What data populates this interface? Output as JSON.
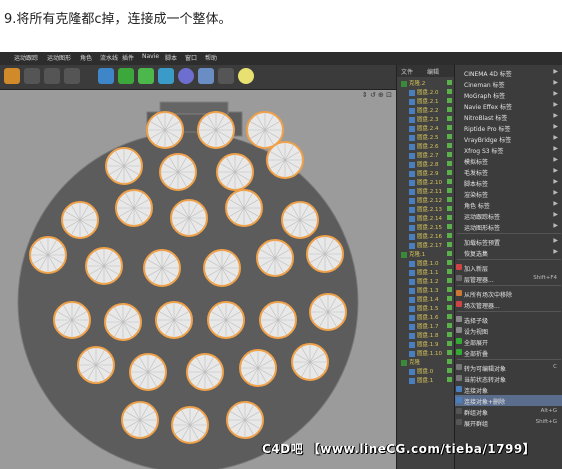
{
  "caption": "9.将所有克隆都c掉，连接成一个整体。",
  "menu_bar": [
    "运动跟踪",
    "运动图形",
    "角色",
    "流水线",
    "插件",
    "Navie",
    "脚本",
    "窗口",
    "帮助"
  ],
  "viewport_menu": "⇕ ↺ ⊕ ⊡",
  "object_panel": {
    "tabs": [
      "文件",
      "编辑"
    ],
    "top_item": "克隆.2",
    "items": [
      "圆盘.2.0",
      "圆盘.2.1",
      "圆盘.2.2",
      "圆盘.2.3",
      "圆盘.2.4",
      "圆盘.2.5",
      "圆盘.2.6",
      "圆盘.2.7",
      "圆盘.2.8",
      "圆盘.2.9",
      "圆盘.2.10",
      "圆盘.2.11",
      "圆盘.2.12",
      "圆盘.2.13",
      "圆盘.2.14",
      "圆盘.2.15",
      "圆盘.2.16",
      "圆盘.2.17"
    ],
    "group2": "克隆.1",
    "items2": [
      "圆盘.1.0",
      "圆盘.1.1",
      "圆盘.1.2",
      "圆盘.1.3",
      "圆盘.1.4",
      "圆盘.1.5",
      "圆盘.1.6",
      "圆盘.1.7",
      "圆盘.1.8",
      "圆盘.1.9",
      "圆盘.1.10"
    ],
    "group3": "克隆",
    "items3": [
      "圆盘.0",
      "圆盘.1"
    ]
  },
  "context_menu": {
    "submenus": [
      "CINEMA 4D 标签",
      "Cineman 标签",
      "MoGraph 标签",
      "Navie Effex 标签",
      "NitroBlast 标签",
      "Riptide Pro 标签",
      "VrayBridge 标签",
      "Xfrog S3 标签",
      "模拟标签",
      "毛发标签",
      "脚本标签",
      "渲染标签",
      "角色 标签",
      "运动跟踪标签",
      "运动图形标签"
    ],
    "presets": [
      "加载标签预置",
      "恢复选集"
    ],
    "items": [
      {
        "label": "加入新层",
        "shortcut": ""
      },
      {
        "label": "层管理器...",
        "shortcut": "Shift+F4"
      },
      {
        "label": "从所有场次中移除",
        "shortcut": ""
      },
      {
        "label": "场次管理器...",
        "shortcut": ""
      },
      {
        "label": "选择子级",
        "shortcut": ""
      },
      {
        "label": "设为视图",
        "shortcut": ""
      },
      {
        "label": "全部展开",
        "shortcut": ""
      },
      {
        "label": "全部折叠",
        "shortcut": ""
      },
      {
        "label": "转为可编辑对象",
        "shortcut": "C"
      },
      {
        "label": "当前状态转对象",
        "shortcut": ""
      },
      {
        "label": "连接对象",
        "shortcut": ""
      },
      {
        "label": "连接对象+删除",
        "shortcut": ""
      },
      {
        "label": "群组对象",
        "shortcut": "Alt+G"
      },
      {
        "label": "展开群组",
        "shortcut": "Shift+G"
      }
    ],
    "highlighted": "连接对象+删除"
  },
  "watermark": "C4D吧 【www.lineCG.com/tieba/1799】",
  "colors": {
    "viewport": "#9b9b9b",
    "body": "#5c5c5c",
    "edge": "#f0a046",
    "highlight": "#5a6d8c"
  }
}
